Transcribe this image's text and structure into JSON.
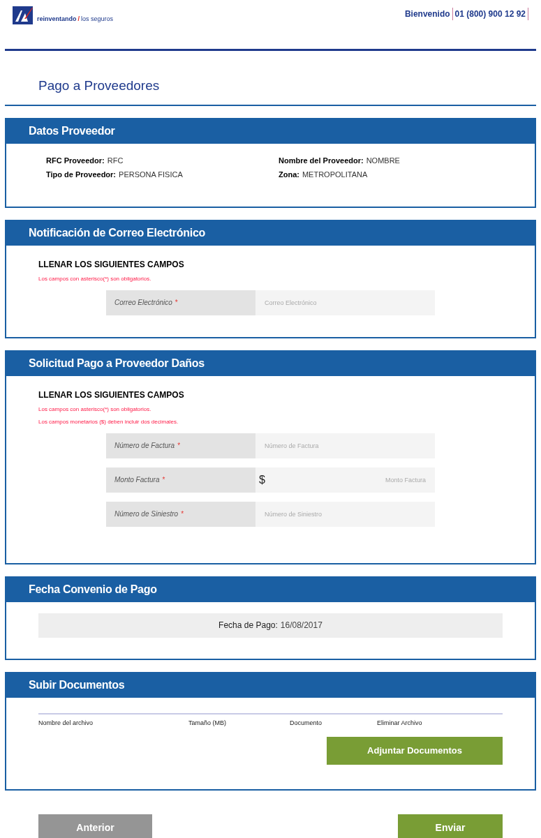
{
  "header": {
    "tagline_bold": "reinventando",
    "tagline_slash": "/",
    "tagline_rest": "los seguros",
    "welcome": "Bienvenido",
    "phone": "01 (800) 900 12 92"
  },
  "page_title": "Pago a Proveedores",
  "sections": [
    {
      "kind": "info",
      "title": "Datos Proveedor",
      "rows": [
        {
          "left": {
            "label": "RFC Proveedor:",
            "value": "RFC"
          },
          "right": {
            "label": "Nombre del Proveedor:",
            "value": "NOMBRE"
          }
        },
        {
          "left": {
            "label": "Tipo de Proveedor:",
            "value": "PERSONA FISICA"
          },
          "right": {
            "label": "Zona:",
            "value": "METROPOLITANA"
          }
        }
      ]
    },
    {
      "kind": "form",
      "title": "Notificación de Correo Electrónico",
      "instruction": "LLENAR LOS SIGUIENTES CAMPOS",
      "notes": [
        "Los campos con asterisco(*) son obligatorios."
      ],
      "fields": [
        {
          "label": "Correo Electrónico",
          "required_mark": "*",
          "placeholder": "Correo Electrónico"
        }
      ]
    },
    {
      "kind": "form",
      "title": "Solicitud Pago a Proveedor Daños",
      "instruction": "LLENAR LOS SIGUIENTES CAMPOS",
      "notes": [
        "Los campos con asterisco(*) son obligatorios.",
        "Los campos monetarios ($) deben incluir dos decimales."
      ],
      "fields": [
        {
          "label": "Número de Factura",
          "required_mark": "*",
          "placeholder": "Número de Factura"
        },
        {
          "label": "Monto Factura",
          "required_mark": "*",
          "prefix": "$",
          "placeholder": "Monto Factura"
        },
        {
          "label": "Número de Siniestro",
          "required_mark": "*",
          "placeholder": "Número de Siniestro"
        }
      ]
    },
    {
      "kind": "date",
      "title": "Fecha Convenio de Pago",
      "label": "Fecha de Pago:",
      "value": "16/08/2017"
    },
    {
      "kind": "upload",
      "title": "Subir Documentos",
      "columns": [
        "Nombre del archivo",
        "Tamaño (MB)",
        "Documento",
        "Eliminar Archivo"
      ],
      "button": "Adjuntar Documentos"
    }
  ],
  "footer_buttons": [
    {
      "label": "Anterior",
      "kind": "secondary"
    },
    {
      "label": "Enviar",
      "kind": "primary"
    }
  ]
}
